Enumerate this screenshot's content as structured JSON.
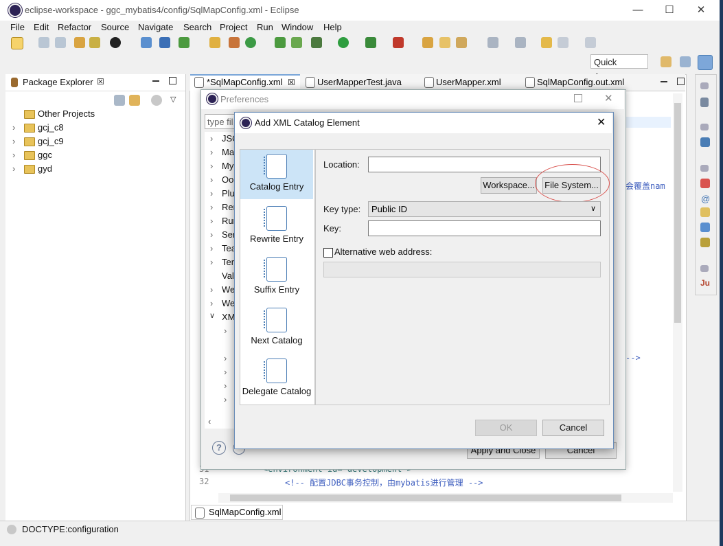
{
  "window": {
    "title": "eclipse-workspace - ggc_mybatis4/config/SqlMapConfig.xml - Eclipse",
    "minimize": "—",
    "maximize": "☐",
    "close": "✕"
  },
  "menu": [
    "File",
    "Edit",
    "Refactor",
    "Source",
    "Navigate",
    "Search",
    "Project",
    "Run",
    "Window",
    "Help"
  ],
  "toolbar": {
    "quick_access": "Quick Access"
  },
  "package_explorer": {
    "title": "Package Explorer",
    "close": "☒",
    "items": [
      {
        "label": "Other Projects",
        "expander": ""
      },
      {
        "label": "gcj_c8",
        "expander": "›"
      },
      {
        "label": "gcj_c9",
        "expander": "›"
      },
      {
        "label": "ggc",
        "expander": "›"
      },
      {
        "label": "gyd",
        "expander": "›"
      }
    ]
  },
  "editor": {
    "tabs": [
      {
        "label": "*SqlMapConfig.xml",
        "close": "☒"
      },
      {
        "label": "UserMapperTest.java"
      },
      {
        "label": "UserMapper.xml"
      },
      {
        "label": "SqlMapConfig.out.xml"
      }
    ],
    "visible_snippets": [
      "会覆盖nam",
      "-->"
    ],
    "lines": [
      {
        "number": "31",
        "text": "<environment id=\"development\">"
      },
      {
        "number": "32",
        "text": "<!-- 配置JDBC事务控制，由mybatis进行管理 -->"
      }
    ],
    "bottom_tab": "SqlMapConfig.xml"
  },
  "preferences": {
    "title": "Preferences",
    "filter_placeholder": "type fil",
    "tree": [
      "JSO",
      "Ma",
      "My",
      "Oo",
      "Plu",
      "Rer",
      "Rur",
      "Ser",
      "Tea",
      "Ter",
      "Val",
      "We",
      "We",
      "XM"
    ],
    "apply_close": "Apply and Close",
    "cancel": "Cancel",
    "help": "?"
  },
  "dialog": {
    "title": "Add XML Catalog Element",
    "close": "✕",
    "entries": [
      {
        "label": "Catalog Entry",
        "selected": true
      },
      {
        "label": "Rewrite Entry",
        "selected": false
      },
      {
        "label": "Suffix Entry",
        "selected": false
      },
      {
        "label": "Next Catalog",
        "selected": false
      },
      {
        "label": "Delegate Catalog",
        "selected": false
      }
    ],
    "location_label": "Location:",
    "location_value": "",
    "workspace_button": "Workspace...",
    "file_system_button": "File System...",
    "key_type_label": "Key type:",
    "key_type_value": "Public ID",
    "key_label": "Key:",
    "key_value": "",
    "alt_web_label": "Alternative web address:",
    "ok": "OK",
    "cancel": "Cancel"
  },
  "status": {
    "text": "DOCTYPE:configuration"
  },
  "colors": {
    "selection": "#cce4f7",
    "highlight_circle": "#d9534f",
    "dialog_border": "#6a8db8"
  }
}
